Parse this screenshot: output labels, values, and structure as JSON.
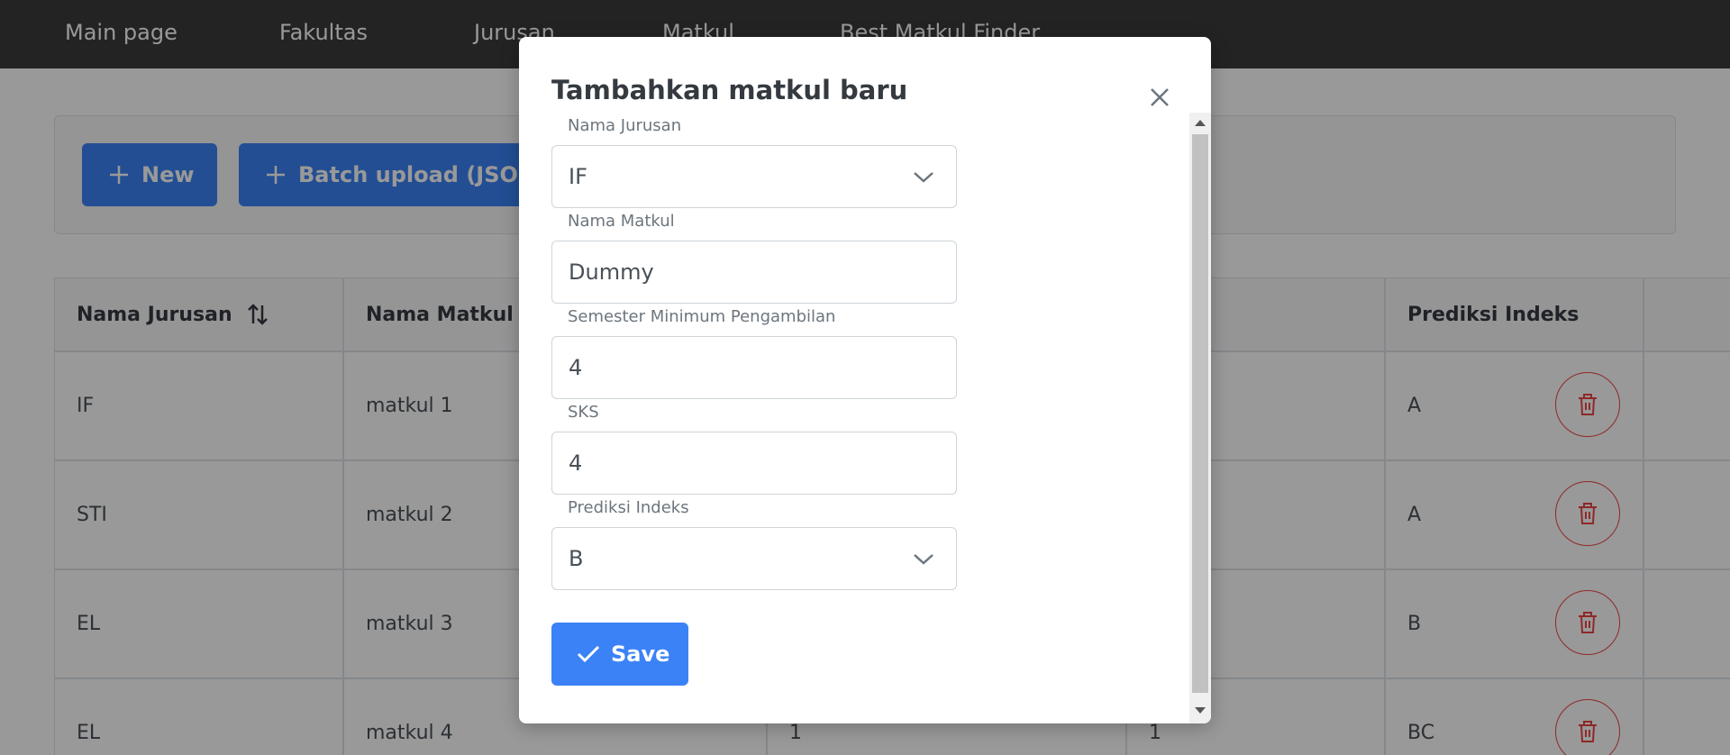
{
  "nav": {
    "items": [
      "Main page",
      "Fakultas",
      "Jurusan",
      "Matkul",
      "Best Matkul Finder"
    ]
  },
  "toolbar": {
    "new_label": "New",
    "batch_label": "Batch upload (JSON file)"
  },
  "table": {
    "headers": [
      "Nama Jurusan",
      "Nama Matkul",
      "",
      "",
      "Prediksi Indeks",
      ""
    ],
    "rows": [
      [
        "IF",
        "matkul 1",
        "",
        "",
        "A"
      ],
      [
        "STI",
        "matkul 2",
        "",
        "",
        "A"
      ],
      [
        "EL",
        "matkul 3",
        "",
        "",
        "B"
      ],
      [
        "EL",
        "matkul 4",
        "1",
        "1",
        "BC"
      ]
    ]
  },
  "dialog": {
    "title": "Tambahkan matkul baru",
    "fields": [
      {
        "label": "Nama Jurusan",
        "value": "IF",
        "type": "select"
      },
      {
        "label": "Nama Matkul",
        "value": "Dummy",
        "type": "input"
      },
      {
        "label": "Semester Minimum Pengambilan",
        "value": "4",
        "type": "input"
      },
      {
        "label": "SKS",
        "value": "4",
        "type": "input"
      },
      {
        "label": "Prediksi Indeks",
        "value": "B",
        "type": "select"
      }
    ],
    "save_label": "Save"
  },
  "colors": {
    "primary": "#3b82f6",
    "danger": "#ef4444",
    "navbar": "#3b3b3b"
  }
}
